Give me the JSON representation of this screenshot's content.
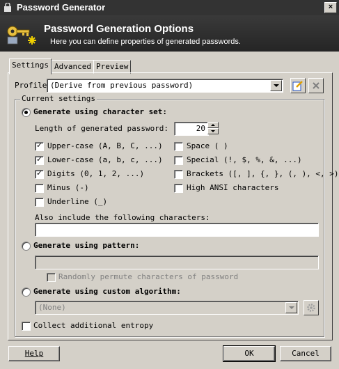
{
  "window": {
    "title": "Password Generator",
    "close_glyph": "×"
  },
  "header": {
    "title": "Password Generation Options",
    "subtitle": "Here you can define properties of generated passwords."
  },
  "tabs": [
    {
      "label": "Settings",
      "active": true
    },
    {
      "label": "Advanced",
      "active": false
    },
    {
      "label": "Preview",
      "active": false
    }
  ],
  "profile": {
    "label": "Profile:",
    "value": "(Derive from previous password)"
  },
  "current_settings": {
    "label": "Current settings"
  },
  "charset": {
    "label": "Generate using character set:",
    "selected": true,
    "length_label": "Length of generated password:",
    "length_value": "20",
    "options_left": [
      {
        "label": "Upper-case (A, B, C, ...)",
        "checked": true
      },
      {
        "label": "Lower-case (a, b, c, ...)",
        "checked": true
      },
      {
        "label": "Digits (0, 1, 2, ...)",
        "checked": true
      },
      {
        "label": "Minus (-)",
        "checked": false
      },
      {
        "label": "Underline (_)",
        "checked": false
      }
    ],
    "options_right": [
      {
        "label": "Space ( )",
        "checked": false
      },
      {
        "label": "Special (!, $, %, &, ...)",
        "checked": false
      },
      {
        "label": "Brackets ([, ], {, }, (, ), <, >)",
        "checked": false
      },
      {
        "label": "High ANSI characters",
        "checked": false
      }
    ],
    "also_include_label": "Also include the following characters:",
    "also_include_value": ""
  },
  "pattern": {
    "label": "Generate using pattern:",
    "selected": false,
    "value": "",
    "permute_label": "Randomly permute characters of password",
    "permute_checked": false
  },
  "custom": {
    "label": "Generate using custom algorithm:",
    "selected": false,
    "value": "(None)"
  },
  "entropy": {
    "label": "Collect additional entropy",
    "checked": false
  },
  "buttons": {
    "help": "Help",
    "ok": "OK",
    "cancel": "Cancel"
  },
  "colors": {
    "titlebar": "#333333",
    "banner": "#2b2b2b",
    "face": "#d4d0c8",
    "disabled_text": "#808080"
  }
}
